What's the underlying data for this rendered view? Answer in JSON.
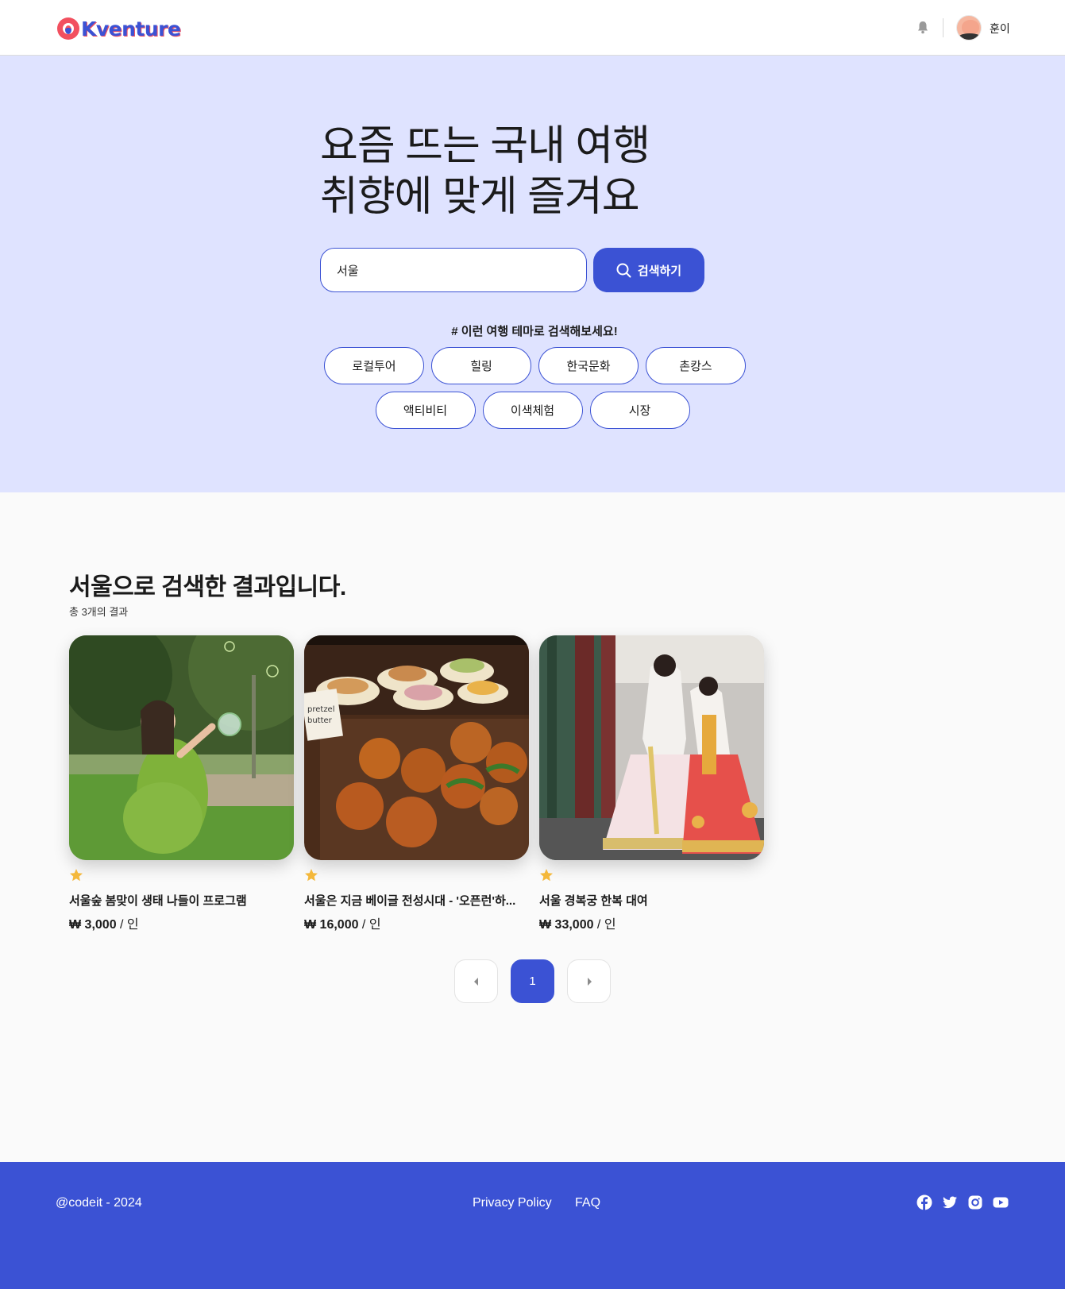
{
  "header": {
    "logo_text": "Kventure",
    "username": "훈이"
  },
  "hero": {
    "title_line1": "요즘 뜨는 국내 여행",
    "title_line2": "취향에 맞게 즐겨요",
    "search_value": "서울",
    "search_button": "검색하기",
    "themes_caption": "# 이런 여행 테마로 검색해보세요!",
    "themes": [
      "로컬투어",
      "힐링",
      "한국문화",
      "촌캉스",
      "액티비티",
      "이색체험",
      "시장"
    ]
  },
  "results": {
    "keyword": "서울",
    "title_suffix": "으로 검색한 결과입니다.",
    "count_text": "총 3개의 결과",
    "items": [
      {
        "title": "서울숲 봄맞이 생태 나들이 프로그램",
        "price": "₩ 3,000",
        "unit": " / 인"
      },
      {
        "title": "서울은 지금 베이글 전성시대 - '오픈런'하...",
        "price": "₩ 16,000",
        "unit": " / 인"
      },
      {
        "title": "서울 경복궁 한복 대여",
        "price": "₩ 33,000",
        "unit": " / 인"
      }
    ]
  },
  "pagination": {
    "current_page": "1"
  },
  "footer": {
    "copyright": "@codeit - 2024",
    "privacy": "Privacy Policy",
    "faq": "FAQ"
  },
  "colors": {
    "brand": "#3b52d4",
    "hero_bg": "#dfe3ff",
    "accent_red": "#f2505f",
    "star": "#f4b83b"
  },
  "icons": [
    "bell-icon",
    "search-icon",
    "star-icon",
    "chevron-left-icon",
    "chevron-right-icon",
    "facebook-icon",
    "twitter-icon",
    "instagram-icon",
    "youtube-icon"
  ]
}
